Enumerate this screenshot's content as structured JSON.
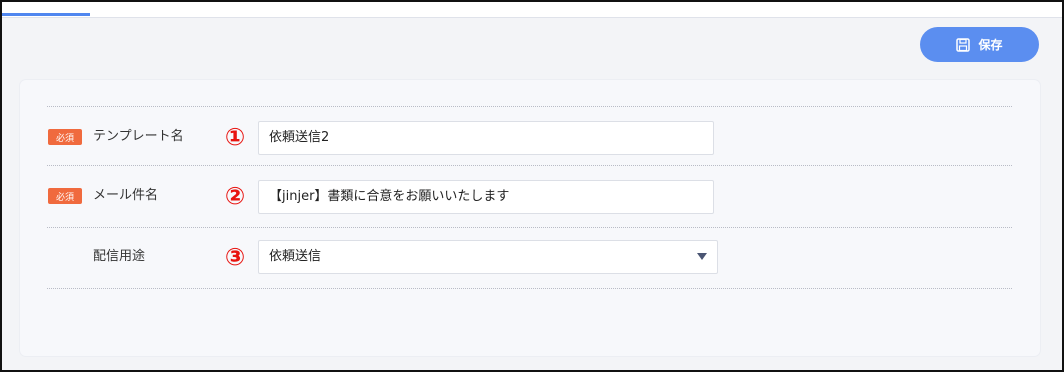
{
  "toolbar": {
    "save_label": "保存"
  },
  "form": {
    "required_label": "必須",
    "fields": [
      {
        "label": "テンプレート名",
        "marker": "①",
        "value": "依頼送信2",
        "required": true
      },
      {
        "label": "メール件名",
        "marker": "②",
        "value": "【jinjer】書類に合意をお願いいたします",
        "required": true
      },
      {
        "label": "配信用途",
        "marker": "③",
        "value": "依頼送信",
        "required": false
      }
    ]
  },
  "colors": {
    "accent": "#5b8ef0",
    "required_badge": "#f06a3e",
    "annotation": "#e8130f"
  },
  "icons": {
    "save": "floppy-disk-icon",
    "dropdown": "chevron-down-icon"
  }
}
